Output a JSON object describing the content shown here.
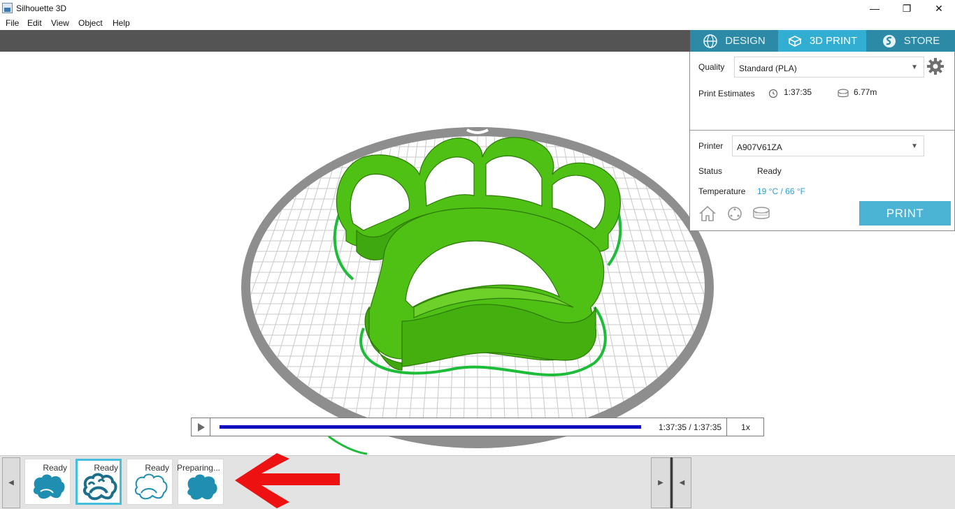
{
  "window": {
    "title": "Silhouette 3D",
    "minimize": "—",
    "maximize": "❐",
    "close": "✕"
  },
  "menu": {
    "items": [
      "File",
      "Edit",
      "View",
      "Object",
      "Help"
    ]
  },
  "mode_tabs": [
    {
      "label": "DESIGN",
      "icon": "globe-icon",
      "active": false
    },
    {
      "label": "3D PRINT",
      "icon": "print-box-icon",
      "active": true
    },
    {
      "label": "STORE",
      "icon": "silhouette-s-icon",
      "active": false
    }
  ],
  "panel": {
    "quality_label": "Quality",
    "quality_value": "Standard (PLA)",
    "print_estimates_label": "Print Estimates",
    "estimate_time": "1:37:35",
    "estimate_filament": "6.77m",
    "printer_label": "Printer",
    "printer_value": "A907V61ZA",
    "status_label": "Status",
    "status_value": "Ready",
    "temperature_label": "Temperature",
    "temperature_value": "19 °C / 66 °F",
    "print_button": "PRINT",
    "colors": {
      "accent": "#32aed2",
      "print_button": "#4bb3d3",
      "temperature": "#2aa0d8"
    }
  },
  "timeline": {
    "time_readout": "1:37:35 / 1:37:35",
    "speed": "1x",
    "progress_fraction": 1.0
  },
  "tray": {
    "jobs": [
      {
        "status": "Ready",
        "selected": false,
        "icon": "paw-print-filled-icon"
      },
      {
        "status": "Ready",
        "selected": true,
        "icon": "paw-print-cutter-icon"
      },
      {
        "status": "Ready",
        "selected": false,
        "icon": "paw-print-outline-icon"
      },
      {
        "status": "Preparing...",
        "selected": false,
        "icon": "paw-print-blob-icon"
      }
    ]
  },
  "scene": {
    "model_color": "#4fc014",
    "annotation_color": "#ee1111"
  }
}
